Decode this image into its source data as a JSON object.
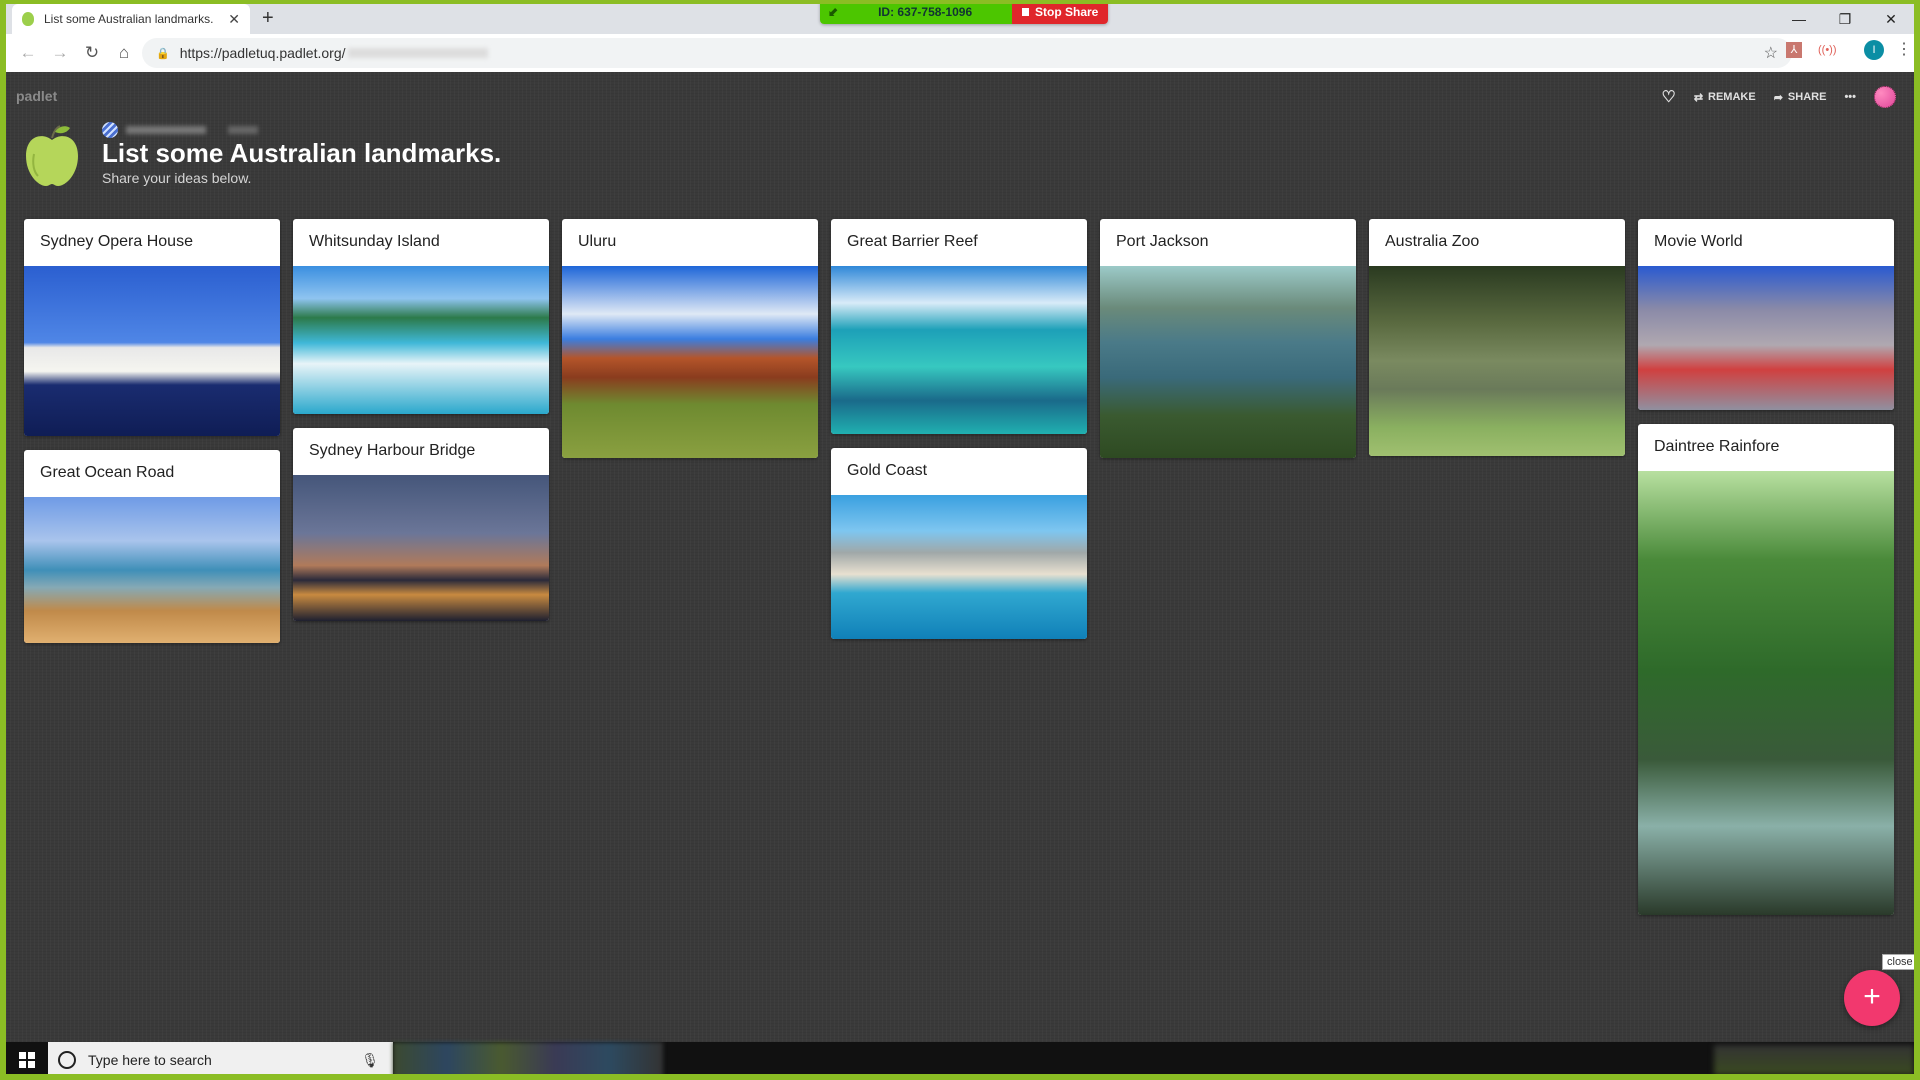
{
  "browser": {
    "tab_title": "List some Australian landmarks.",
    "tab_close": "✕",
    "new_tab": "+",
    "url": "https://padletuq.padlet.org/",
    "window_controls": {
      "minimize": "—",
      "restore": "❐",
      "close": "✕"
    },
    "nav": {
      "back": "←",
      "forward": "→",
      "reload": "↻",
      "home": "⌂",
      "lock": "🔒",
      "bookmark": "☆"
    },
    "extensions": {
      "pdf": "⅄",
      "cast": "((•))",
      "profile_initial": "I",
      "menu": "⋮"
    }
  },
  "zoom_share": {
    "meeting_id": "ID: 637-758-1096",
    "stop_label": "Stop Share"
  },
  "padlet": {
    "brand": "padlet",
    "toolbar": {
      "heart": "♡",
      "remake": "REMAKE",
      "share": "SHARE",
      "more": "•••"
    },
    "title": "List some Australian landmarks.",
    "subtitle": "Share your ideas below.",
    "columns": [
      [
        {
          "title": "Sydney Opera House",
          "scene": "opera"
        },
        {
          "title": "Great Ocean Road",
          "scene": "ocean"
        }
      ],
      [
        {
          "title": "Whitsunday Island",
          "scene": "whitsunday"
        },
        {
          "title": "Sydney Harbour Bridge",
          "scene": "bridge"
        }
      ],
      [
        {
          "title": "Uluru",
          "scene": "uluru"
        }
      ],
      [
        {
          "title": "Great Barrier Reef",
          "scene": "reef"
        },
        {
          "title": "Gold Coast",
          "scene": "goldcoast"
        }
      ],
      [
        {
          "title": "Port Jackson",
          "scene": "portjackson"
        }
      ],
      [
        {
          "title": "Australia Zoo",
          "scene": "zoo"
        }
      ],
      [
        {
          "title": "Movie World",
          "scene": "movieworld"
        },
        {
          "title": "Daintree Rainfore",
          "scene": "daintree"
        }
      ]
    ],
    "fab_label": "+",
    "fab_tooltip": "close"
  },
  "taskbar": {
    "search_placeholder": "Type here to search",
    "mic": "🎙"
  }
}
